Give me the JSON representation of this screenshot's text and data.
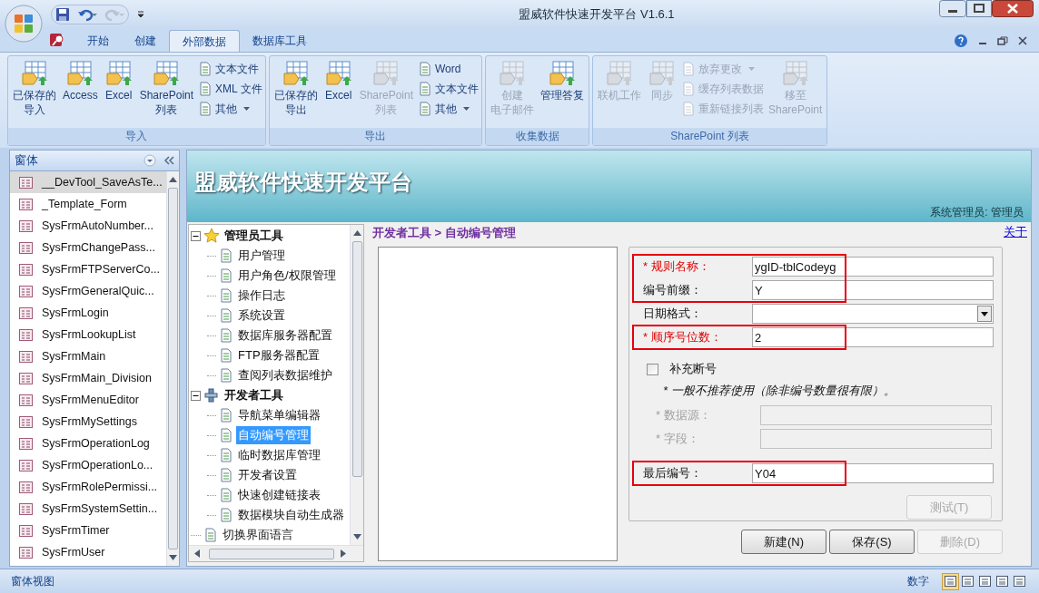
{
  "window": {
    "title": "盟威软件快速开发平台 V1.6.1"
  },
  "ribbon_tabs": [
    {
      "label": "开始",
      "selected": false
    },
    {
      "label": "创建",
      "selected": false
    },
    {
      "label": "外部数据",
      "selected": true
    },
    {
      "label": "数据库工具",
      "selected": false
    }
  ],
  "ribbon_groups": [
    {
      "label": "导入",
      "items": [
        {
          "kind": "large",
          "lines": [
            "已保存的",
            "导入"
          ],
          "disabled": false
        },
        {
          "kind": "large",
          "lines": [
            "Access"
          ],
          "disabled": false
        },
        {
          "kind": "large",
          "lines": [
            "Excel"
          ],
          "disabled": false
        },
        {
          "kind": "large",
          "lines": [
            "SharePoint",
            "列表"
          ],
          "disabled": false
        },
        {
          "kind": "stack",
          "items": [
            {
              "label": "文本文件",
              "dropdown": false,
              "disabled": false
            },
            {
              "label": "XML 文件",
              "dropdown": false,
              "disabled": false
            },
            {
              "label": "其他",
              "dropdown": true,
              "disabled": false
            }
          ]
        }
      ]
    },
    {
      "label": "导出",
      "items": [
        {
          "kind": "large",
          "lines": [
            "已保存的",
            "导出"
          ],
          "disabled": false
        },
        {
          "kind": "large",
          "lines": [
            "Excel"
          ],
          "disabled": false
        },
        {
          "kind": "large",
          "lines": [
            "SharePoint",
            "列表"
          ],
          "disabled": true
        },
        {
          "kind": "stack",
          "items": [
            {
              "label": "Word",
              "dropdown": false,
              "disabled": false
            },
            {
              "label": "文本文件",
              "dropdown": false,
              "disabled": false
            },
            {
              "label": "其他",
              "dropdown": true,
              "disabled": false
            }
          ]
        }
      ]
    },
    {
      "label": "收集数据",
      "items": [
        {
          "kind": "large",
          "lines": [
            "创建",
            "电子邮件"
          ],
          "disabled": true
        },
        {
          "kind": "large",
          "lines": [
            "管理答复"
          ],
          "disabled": false
        }
      ]
    },
    {
      "label": "SharePoint 列表",
      "items": [
        {
          "kind": "large",
          "lines": [
            "联机工作"
          ],
          "disabled": true
        },
        {
          "kind": "large",
          "lines": [
            "同步"
          ],
          "disabled": true
        },
        {
          "kind": "stack",
          "items": [
            {
              "label": "放弃更改",
              "dropdown": true,
              "disabled": true
            },
            {
              "label": "缓存列表数据",
              "dropdown": false,
              "disabled": true
            },
            {
              "label": "重新链接列表",
              "dropdown": false,
              "disabled": true
            }
          ]
        },
        {
          "kind": "large",
          "lines": [
            "移至",
            "SharePoint"
          ],
          "disabled": true
        }
      ]
    }
  ],
  "nav_pane": {
    "title": "窗体",
    "items": [
      {
        "label": "__DevTool_SaveAsTe...",
        "selected": true
      },
      {
        "label": "_Template_Form",
        "selected": false
      },
      {
        "label": "SysFrmAutoNumber...",
        "selected": false
      },
      {
        "label": "SysFrmChangePass...",
        "selected": false
      },
      {
        "label": "SysFrmFTPServerCo...",
        "selected": false
      },
      {
        "label": "SysFrmGeneralQuic...",
        "selected": false
      },
      {
        "label": "SysFrmLogin",
        "selected": false
      },
      {
        "label": "SysFrmLookupList",
        "selected": false
      },
      {
        "label": "SysFrmMain",
        "selected": false
      },
      {
        "label": "SysFrmMain_Division",
        "selected": false
      },
      {
        "label": "SysFrmMenuEditor",
        "selected": false
      },
      {
        "label": "SysFrmMySettings",
        "selected": false
      },
      {
        "label": "SysFrmOperationLog",
        "selected": false
      },
      {
        "label": "SysFrmOperationLo...",
        "selected": false
      },
      {
        "label": "SysFrmRolePermissi...",
        "selected": false
      },
      {
        "label": "SysFrmSystemSettin...",
        "selected": false
      },
      {
        "label": "SysFrmTimer",
        "selected": false
      },
      {
        "label": "SysFrmUser",
        "selected": false
      }
    ]
  },
  "banner": {
    "title": "盟威软件快速开发平台",
    "user": "系统管理员: 管理员"
  },
  "breadcrumb": "开发者工具 > 自动编号管理",
  "about_link": "关于",
  "tree": [
    {
      "label": "管理员工具",
      "expanded": true,
      "selected": false,
      "children": [
        {
          "label": "用户管理",
          "selected": false
        },
        {
          "label": "用户角色/权限管理",
          "selected": false
        },
        {
          "label": "操作日志",
          "selected": false
        },
        {
          "label": "系统设置",
          "selected": false
        },
        {
          "label": "数据库服务器配置",
          "selected": false
        },
        {
          "label": "FTP服务器配置",
          "selected": false
        },
        {
          "label": "查阅列表数据维护",
          "selected": false
        }
      ]
    },
    {
      "label": "开发者工具",
      "expanded": true,
      "selected": false,
      "children": [
        {
          "label": "导航菜单编辑器",
          "selected": false
        },
        {
          "label": "自动编号管理",
          "selected": true
        },
        {
          "label": "临时数据库管理",
          "selected": false
        },
        {
          "label": "开发者设置",
          "selected": false
        },
        {
          "label": "快速创建链接表",
          "selected": false
        },
        {
          "label": "数据模块自动生成器",
          "selected": false
        }
      ]
    },
    {
      "label": "切换界面语言",
      "selected": false
    }
  ],
  "form": {
    "fields": [
      {
        "kind": "text",
        "label": "* 规则名称：",
        "value": "ygID-tblCodeyg",
        "required": true,
        "highlighted": true,
        "disabled": false
      },
      {
        "kind": "text",
        "label": "编号前缀：",
        "value": "Y",
        "required": false,
        "highlighted": true,
        "disabled": false
      },
      {
        "kind": "select",
        "label": "日期格式：",
        "required": false,
        "highlighted": false,
        "disabled": false
      },
      {
        "kind": "text",
        "label": "* 顺序号位数：",
        "value": "2",
        "required": true,
        "highlighted": true,
        "disabled": false
      },
      {
        "kind": "checkbox",
        "label": "补充断号",
        "checked": false
      },
      {
        "kind": "note",
        "label": "* 一般不推荐使用（除非编号数量很有限）。"
      },
      {
        "kind": "text",
        "label": "* 数据源：",
        "highlighted": false,
        "disabled": true
      },
      {
        "kind": "text",
        "label": "* 字段：",
        "highlighted": false,
        "disabled": true
      },
      {
        "kind": "text",
        "label": "最后编号：",
        "value": "Y04",
        "required": false,
        "highlighted": true,
        "disabled": false
      }
    ],
    "test_button": {
      "label": "测试(T)",
      "disabled": true
    },
    "buttons": [
      {
        "label": "新建(N)",
        "disabled": false
      },
      {
        "label": "保存(S)",
        "disabled": false
      },
      {
        "label": "删除(D)",
        "disabled": true
      }
    ]
  },
  "status_bar": {
    "left": "窗体视图",
    "mode": "数字",
    "views": [
      {
        "selected": true
      },
      {
        "selected": false
      },
      {
        "selected": false
      },
      {
        "selected": false
      },
      {
        "selected": false
      }
    ]
  }
}
